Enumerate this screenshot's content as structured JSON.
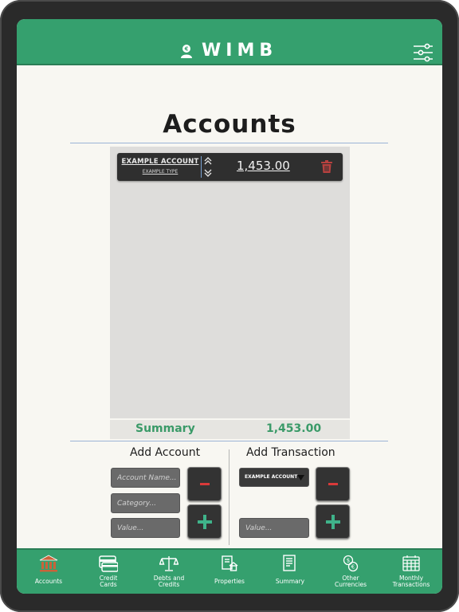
{
  "app": {
    "title": "WIMB",
    "logo_icon": "user-euro-icon",
    "settings_icon": "sliders-icon"
  },
  "page": {
    "title": "Accounts"
  },
  "accounts": [
    {
      "name": "EXAMPLE ACCOUNT",
      "type": "EXAMPLE TYPE",
      "value": "1,453.00",
      "move_icon": "reorder-arrows-icon",
      "delete_icon": "trash-icon"
    }
  ],
  "summary": {
    "label": "Summary",
    "value": "1,453.00"
  },
  "add_account": {
    "title": "Add Account",
    "name_placeholder": "Account Name...",
    "category_placeholder": "Category...",
    "value_placeholder": "Value..."
  },
  "add_transaction": {
    "title": "Add Transaction",
    "selected_account": "EXAMPLE ACCOUNT",
    "value_placeholder": "Value..."
  },
  "nav": [
    {
      "label": "Accounts",
      "icon": "bank-icon"
    },
    {
      "label": "Credit\nCards",
      "icon": "credit-card-icon"
    },
    {
      "label": "Debts and\nCredits",
      "icon": "scales-icon"
    },
    {
      "label": "Properties",
      "icon": "house-document-icon"
    },
    {
      "label": "Summary",
      "icon": "summary-document-icon"
    },
    {
      "label": "Other\nCurrencies",
      "icon": "currency-exchange-icon"
    },
    {
      "label": "Monthly\nTransactions",
      "icon": "calendar-icon"
    }
  ],
  "colors": {
    "brand_green": "#35a06e",
    "summary_green": "#3a9a68",
    "delete_red": "#d93a3a",
    "plus_teal": "#3fb38a",
    "accent_blue": "#9bb4d6"
  }
}
